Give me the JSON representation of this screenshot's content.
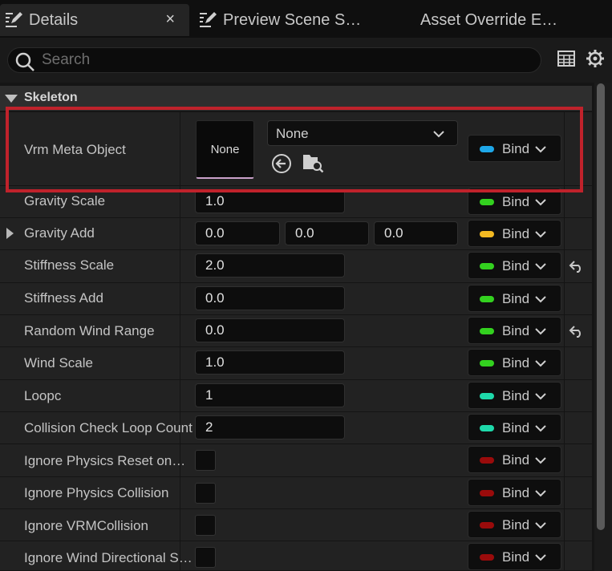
{
  "tabs": [
    {
      "label": "Details",
      "active": true,
      "close": "×"
    },
    {
      "label": "Preview Scene S…",
      "active": false
    },
    {
      "label": "Asset Override E…",
      "active": false
    }
  ],
  "search": {
    "placeholder": "Search",
    "value": ""
  },
  "category": {
    "label": "Skeleton",
    "expanded": true
  },
  "vrm_meta": {
    "name": "Vrm Meta Object",
    "thumbnail_label": "None",
    "combo_value": "None",
    "bind_label": "Bind",
    "bind_color": "#1ea7e8"
  },
  "properties": [
    {
      "name": "Gravity Scale",
      "value": "1.0",
      "bind_label": "Bind",
      "bind_color": "#33d11f"
    },
    {
      "name": "Gravity Add",
      "x": "0.0",
      "y": "0.0",
      "z": "0.0",
      "bind_label": "Bind",
      "bind_color": "#f2b922"
    },
    {
      "name": "Stiffness Scale",
      "value": "2.0",
      "bind_label": "Bind",
      "bind_color": "#33d11f",
      "reset": true
    },
    {
      "name": "Stiffness Add",
      "value": "0.0",
      "bind_label": "Bind",
      "bind_color": "#33d11f"
    },
    {
      "name": "Random Wind Range",
      "value": "0.0",
      "bind_label": "Bind",
      "bind_color": "#33d11f",
      "reset": true
    },
    {
      "name": "Wind Scale",
      "value": "1.0",
      "bind_label": "Bind",
      "bind_color": "#33d11f"
    },
    {
      "name": "Loopc",
      "value": "1",
      "bind_label": "Bind",
      "bind_color": "#1ed9aa"
    },
    {
      "name": "Collision Check Loop Count",
      "value": "2",
      "bind_label": "Bind",
      "bind_color": "#1ed9aa"
    },
    {
      "name": "Ignore Physics Reset on…",
      "checked": false,
      "bind_label": "Bind",
      "bind_color": "#9a0b0b"
    },
    {
      "name": "Ignore Physics Collision",
      "checked": false,
      "bind_label": "Bind",
      "bind_color": "#9a0b0b"
    },
    {
      "name": "Ignore VRMCollision",
      "checked": false,
      "bind_label": "Bind",
      "bind_color": "#9a0b0b"
    },
    {
      "name": "Ignore Wind Directional S…",
      "checked": false,
      "bind_label": "Bind",
      "bind_color": "#9a0b0b"
    }
  ],
  "icons": {
    "tab": "pencil-document-icon",
    "search": "search-icon",
    "table": "table-view-icon",
    "settings": "gear-icon",
    "use": "use-selected-arrow-icon",
    "browse": "browse-folder-icon",
    "reset": "reset-to-default-icon",
    "chevron": "chevron-down-icon"
  }
}
